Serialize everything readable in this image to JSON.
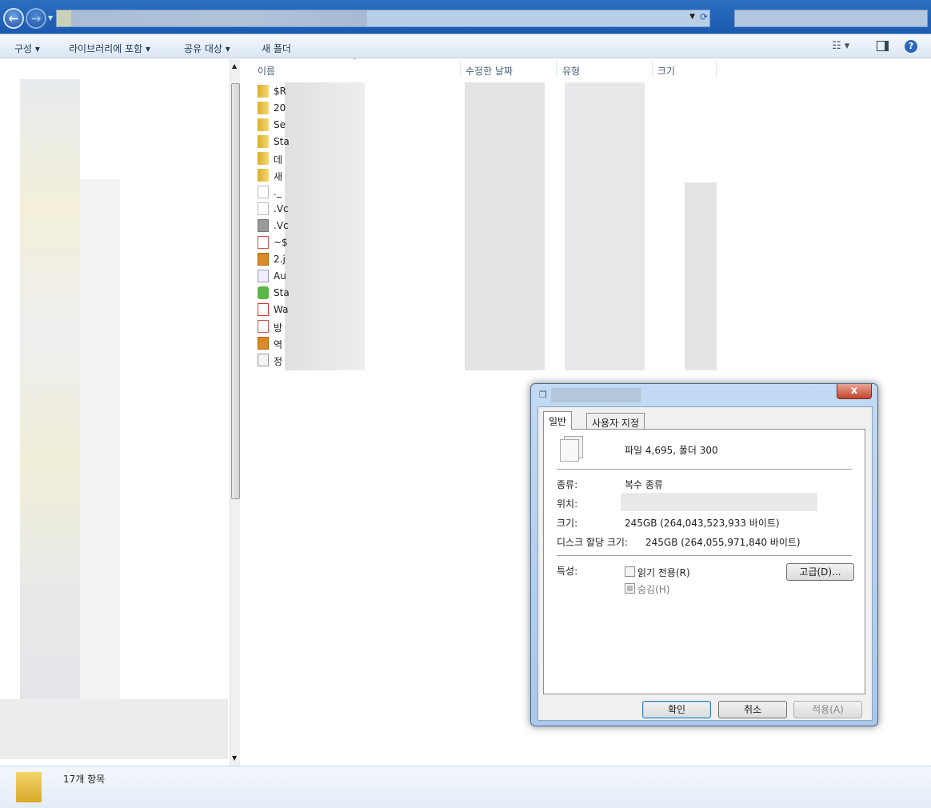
{
  "toolbar": {
    "organize": "구성 ▾",
    "include_library": "라이브러리에 포함 ▾",
    "share_with": "공유 대상 ▾",
    "new_folder": "새 폴더"
  },
  "columns": {
    "name": "이름",
    "modified": "수정한 날짜",
    "type": "유형",
    "size": "크기"
  },
  "files": [
    {
      "name": "$R",
      "icon": "folder-icon"
    },
    {
      "name": "20",
      "icon": "folder-icon"
    },
    {
      "name": "Se",
      "icon": "folder-icon"
    },
    {
      "name": "Sta",
      "icon": "folder-icon"
    },
    {
      "name": "데",
      "icon": "folder-icon"
    },
    {
      "name": "새",
      "icon": "folder-icon"
    },
    {
      "name": "._",
      "icon": "file-icon"
    },
    {
      "name": ".Vc",
      "icon": "file-icon"
    },
    {
      "name": ".Vc",
      "icon": "gray-file-icon"
    },
    {
      "name": "~$",
      "icon": "powerpoint-icon"
    },
    {
      "name": "2.j",
      "icon": "jpg-icon"
    },
    {
      "name": "Au",
      "icon": "settings-file-icon"
    },
    {
      "name": "Sta",
      "icon": "app-icon"
    },
    {
      "name": "Wa",
      "icon": "pdf-icon"
    },
    {
      "name": "방",
      "icon": "powerpoint-icon"
    },
    {
      "name": "역",
      "icon": "jpg-icon"
    },
    {
      "name": "정",
      "icon": "text-file-icon"
    }
  ],
  "status": {
    "count": "17개 항목"
  },
  "dialog": {
    "tabs": [
      "일반",
      "사용자 지정"
    ],
    "summary": "파일 4,695, 폴더 300",
    "type_label": "종류:",
    "type_value": "복수 종류",
    "location_label": "위치:",
    "size_label": "크기:",
    "size_value": "245GB (264,043,523,933 바이트)",
    "disk_label": "디스크 할당 크기:",
    "disk_value": "245GB (264,055,971,840 바이트)",
    "attr_label": "특성:",
    "readonly": "읽기 전용(R)",
    "hidden": "숨김(H)",
    "advanced": "고급(D)...",
    "ok": "확인",
    "cancel": "취소",
    "apply": "적용(A)",
    "close": "x"
  },
  "colors": {
    "folder": "#e8c34a",
    "accent": "#1b5ab0"
  }
}
